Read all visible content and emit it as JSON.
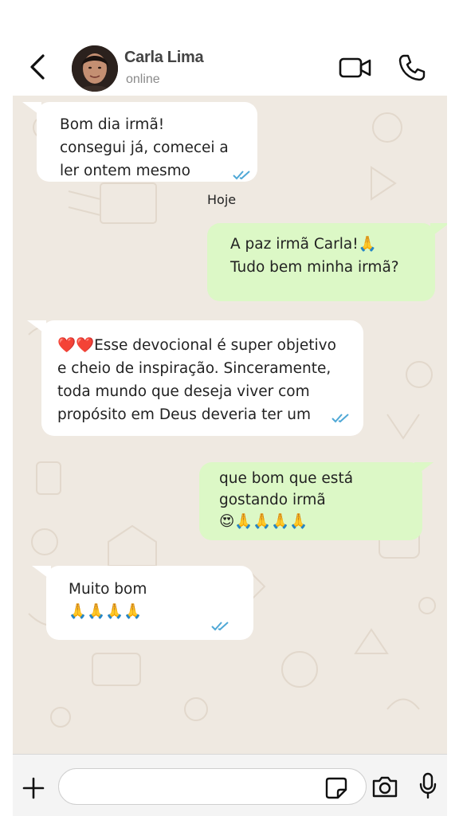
{
  "header": {
    "contact_name": "Carla Lima",
    "status": "online",
    "icons": [
      "back-arrow-icon",
      "video-camera-icon",
      "phone-icon"
    ]
  },
  "messages": [
    {
      "direction": "incoming",
      "text": "Bom dia irmã!\nconsegui já, comecei a\nler ontem mesmo",
      "read": true
    },
    {
      "direction": "separator",
      "text": "Hoje"
    },
    {
      "direction": "outgoing",
      "text": "A paz irmã Carla!🙏\nTudo bem minha irmã?"
    },
    {
      "direction": "incoming",
      "text": "❤️❤️Esse devocional é super objetivo\ne cheio de inspiração. Sinceramente,\ntoda mundo que deseja viver com\npropósito em Deus deveria ter um",
      "read": true
    },
    {
      "direction": "outgoing",
      "text": "que bom que está\ngostando irmã\n😍🙏🙏🙏🙏"
    },
    {
      "direction": "incoming",
      "text": "Muito bom\n🙏🙏🙏🙏",
      "read": true
    }
  ],
  "composer": {
    "placeholder": "",
    "icons": [
      "plus-icon",
      "sticker-icon",
      "camera-icon",
      "microphone-icon"
    ]
  },
  "colors": {
    "incoming_bubble": "#ffffff",
    "outgoing_bubble": "#dcf8c6",
    "chat_background": "#efe9e1",
    "read_ticks": "#4fa8d6"
  }
}
